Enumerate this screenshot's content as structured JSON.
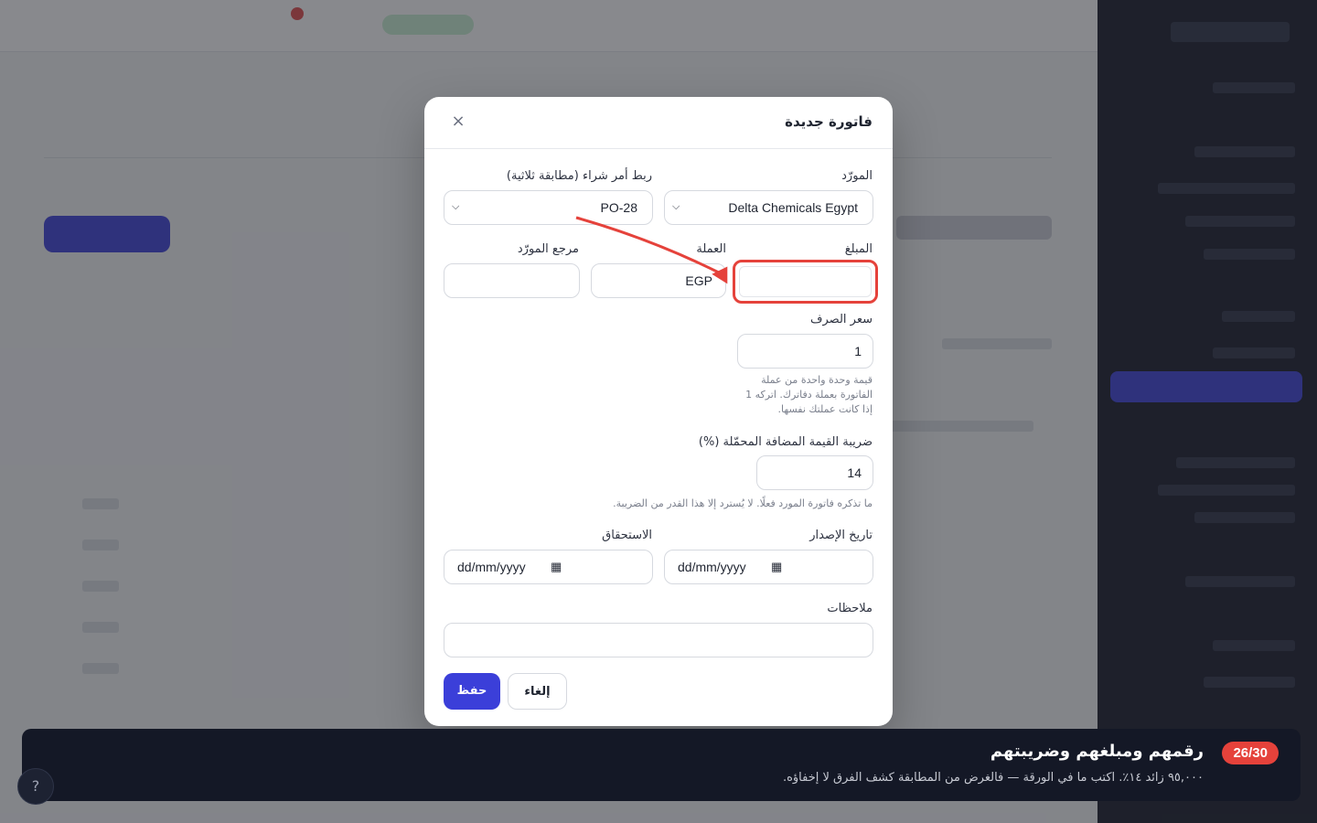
{
  "modal": {
    "title": "فاتورة جديدة",
    "close_icon": "×"
  },
  "fields": {
    "supplier": {
      "label": "المورّد",
      "value": "Delta Chemicals Egypt"
    },
    "po_link": {
      "label": "ربط أمر شراء (مطابقة ثلاثية)",
      "value": "PO-28"
    },
    "amount": {
      "label": "المبلغ",
      "value": ""
    },
    "currency": {
      "label": "العملة",
      "value": "EGP"
    },
    "supplier_ref": {
      "label": "مرجع المورّد",
      "value": ""
    },
    "exchange_rate": {
      "label": "سعر الصرف",
      "value": "1",
      "help_lines": [
        "قيمة وحدة واحدة من عملة",
        "الفاتورة بعملة دفاترك. اتركه 1",
        "إذا كانت عملتك نفسها."
      ]
    },
    "vat": {
      "label": "ضريبة القيمة المضافة المحمّلة (%)",
      "value": "14",
      "help": "ما تذكره فاتورة المورد فعلًا. لا يُسترد إلا هذا القدر من الضريبة."
    },
    "issue_date": {
      "label": "تاريخ الإصدار",
      "placeholder": "dd/mm/yyyy"
    },
    "due_date": {
      "label": "الاستحقاق",
      "placeholder": "dd/mm/yyyy"
    },
    "notes": {
      "label": "ملاحظات",
      "value": ""
    }
  },
  "buttons": {
    "save": "حفظ",
    "cancel": "إلغاء"
  },
  "guide": {
    "step": "26/30",
    "title": "رقمهم ومبلغهم وضريبتهم",
    "description": "٩٥,٠٠٠ زائد ١٤٪. اكتب ما في الورقة — فالغرض من المطابقة كشف الفرق لا إخفاؤه."
  },
  "icons": {
    "close": "close-icon",
    "chevron": "chevron-down-icon",
    "calendar": "calendar-icon",
    "help": "help-icon"
  },
  "colors": {
    "primary": "#3b3fd9",
    "highlight": "#e5423b",
    "banner": "#141826"
  }
}
